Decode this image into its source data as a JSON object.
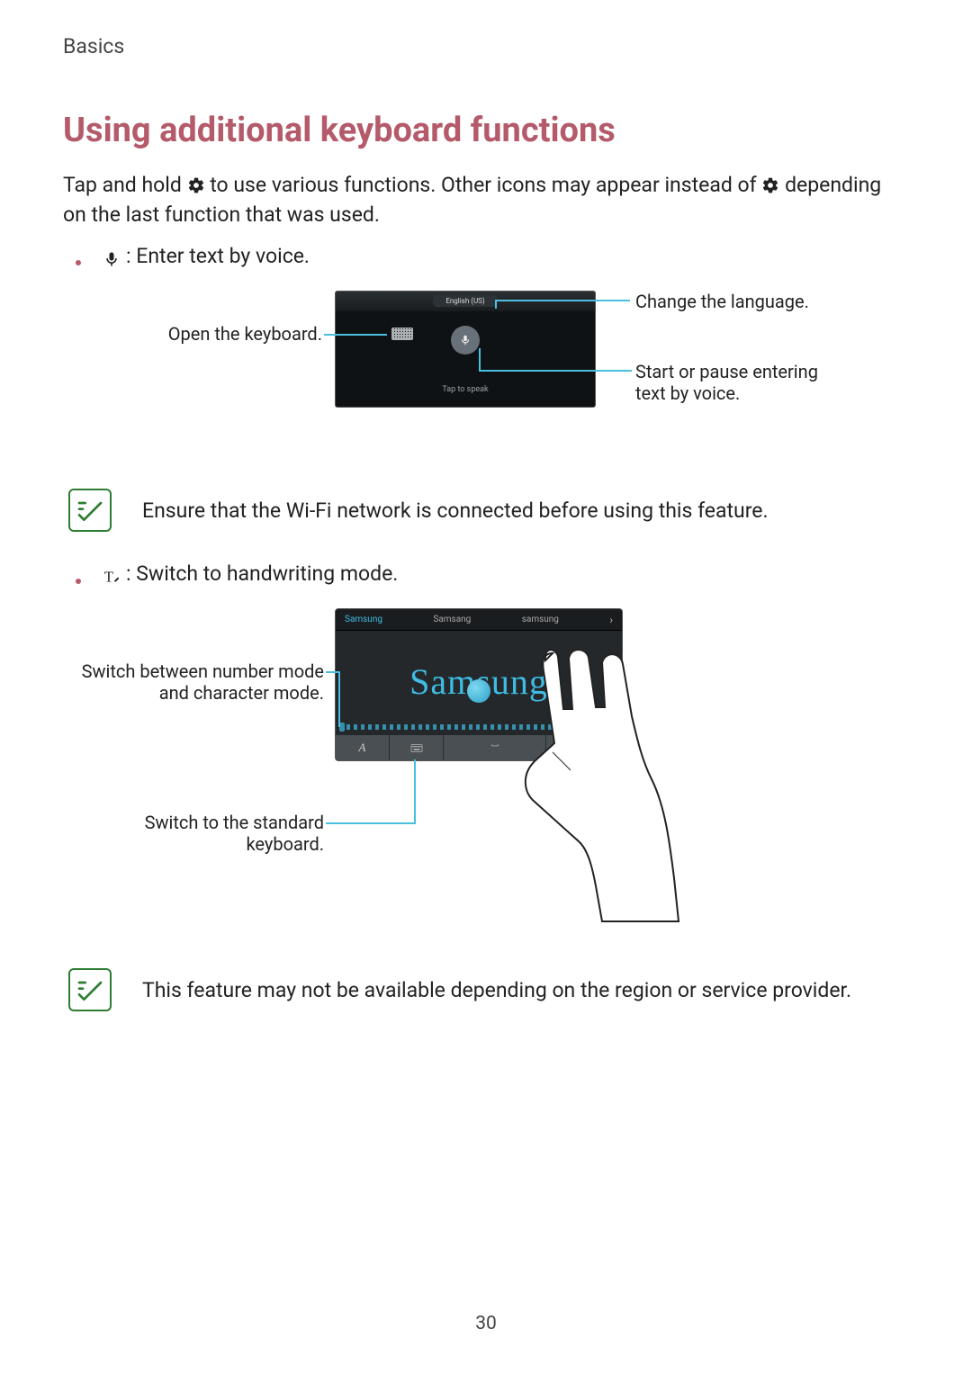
{
  "pageNumber": "30",
  "breadcrumb": "Basics",
  "heading": "Using additional keyboard functions",
  "intro": {
    "pre": "Tap and hold ",
    "mid": " to use various functions. Other icons may appear instead of ",
    "post": " depending on the last function that was used."
  },
  "bullets": {
    "voice": " : Enter text by voice.",
    "handwriting": " : Switch to handwriting mode."
  },
  "fig1": {
    "langText": "English (US)",
    "tapToSpeak": "Tap to speak",
    "callouts": {
      "openKeyboard": "Open the keyboard.",
      "changeLanguage": "Change the language.",
      "startPause": "Start or pause entering text by voice."
    }
  },
  "note1": "Ensure that the Wi-Fi network is connected before using this feature.",
  "fig2": {
    "suggestions": {
      "s1": "Samsung",
      "s2": "Samsang",
      "s3": "samsung"
    },
    "handwritten": "Samsung",
    "keyA": "A",
    "callouts": {
      "switchMode": "Switch between number mode and character mode.",
      "switchStandard": "Switch to the standard keyboard."
    }
  },
  "note2": "This feature may not be available depending on the region or service provider."
}
